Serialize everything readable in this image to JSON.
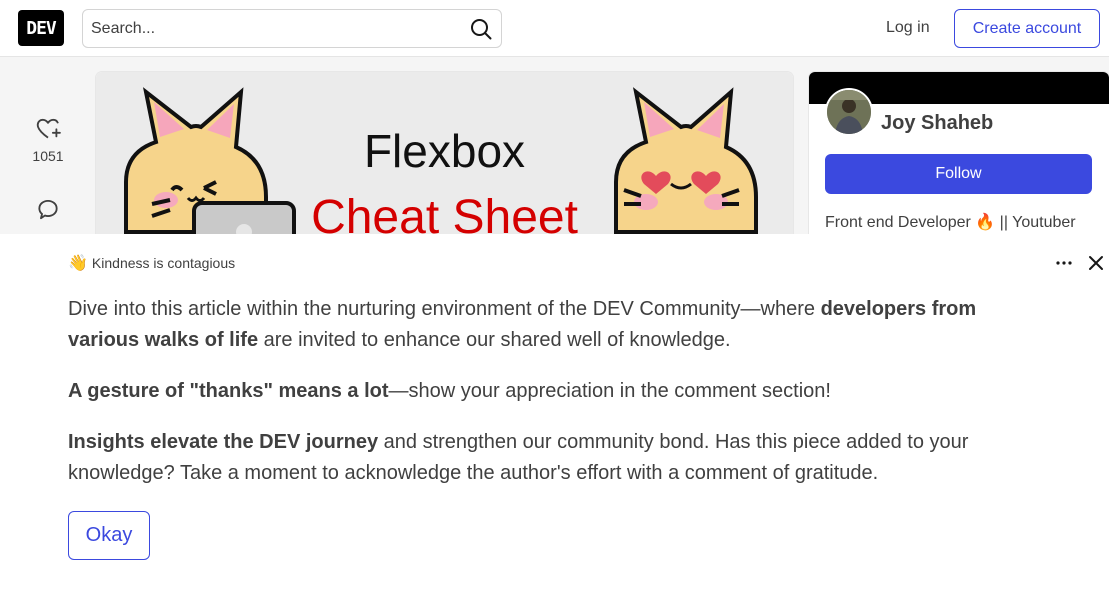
{
  "header": {
    "logo": "DEV",
    "search_placeholder": "Search...",
    "login": "Log in",
    "create_account": "Create account"
  },
  "sidebar": {
    "reactions_count": "1051"
  },
  "article": {
    "cover_line1": "Flexbox",
    "cover_line2": "Cheat Sheet"
  },
  "profile": {
    "name": "Joy Shaheb",
    "follow": "Follow",
    "bio": "Front end Developer 🔥 || Youtuber"
  },
  "modal": {
    "badge_emoji": "👋",
    "badge_text": "Kindness is contagious",
    "p1_a": "Dive into this article within the nurturing environment of the DEV Community—where ",
    "p1_b": "developers from various walks of life",
    "p1_c": " are invited to enhance our shared well of knowledge.",
    "p2_a": "A gesture of \"thanks\" means a lot",
    "p2_b": "—show your appreciation in the comment section!",
    "p3_a": "Insights elevate the DEV journey",
    "p3_b": " and strengthen our community bond. Has this piece added to your knowledge? Take a moment to acknowledge the author's effort with a comment of gratitude.",
    "okay": "Okay"
  },
  "colors": {
    "accent": "#3b49df",
    "cover_red": "#d40000"
  }
}
